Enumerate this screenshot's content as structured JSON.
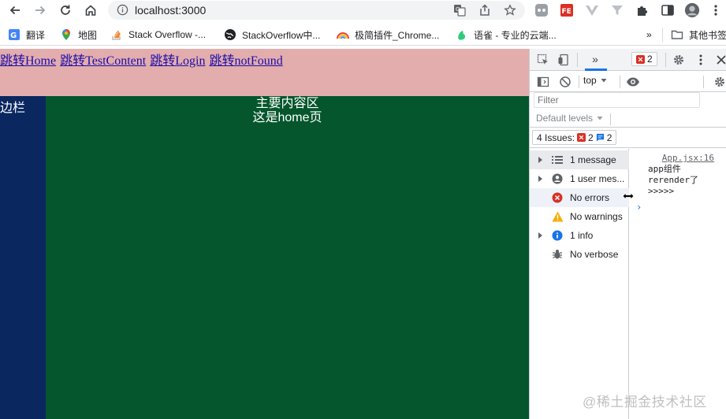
{
  "browser": {
    "url": "localhost:3000"
  },
  "bookmarks": [
    {
      "label": "翻译",
      "icon": "translate-icon"
    },
    {
      "label": "地图",
      "icon": "maps-pin-icon"
    },
    {
      "label": "Stack Overflow -...",
      "icon": "stackoverflow-icon"
    },
    {
      "label": "StackOverflow中...",
      "icon": "globe-icon"
    },
    {
      "label": "极简插件_Chrome...",
      "icon": "rainbow-icon"
    },
    {
      "label": "语雀 - 专业的云端...",
      "icon": "yuque-icon"
    },
    {
      "label": "其他书签",
      "icon": "folder-icon"
    }
  ],
  "bookmarks_more": "»",
  "page": {
    "nav_links": [
      "跳转Home",
      "跳转TestContent",
      "跳转Login",
      "跳转notFound"
    ],
    "sidebar_text": "侧边栏",
    "main_title": "主要内容区",
    "main_subtitle": "这是home页",
    "colors": {
      "header_bg": "#e4adad",
      "sidebar_bg": "#0a2760",
      "main_bg": "#05562d"
    }
  },
  "devtools": {
    "error_count": "2",
    "context": "top",
    "filter_placeholder": "Filter",
    "levels_label": "Default levels",
    "issues_label": "4 Issues:",
    "issues_errors": "2",
    "issues_messages": "2",
    "sidebar_items": [
      {
        "label": "1 message",
        "icon": "list-icon",
        "expandable": true
      },
      {
        "label": "1 user mes...",
        "icon": "user-icon",
        "expandable": true
      },
      {
        "label": "No errors",
        "icon": "error-icon",
        "expandable": false
      },
      {
        "label": "No warnings",
        "icon": "warning-icon",
        "expandable": false
      },
      {
        "label": "1 info",
        "icon": "info-icon",
        "expandable": true
      },
      {
        "label": "No verbose",
        "icon": "bug-icon",
        "expandable": false
      }
    ],
    "console": {
      "source": "App.jsx:16",
      "message": "app组件\nrerender了\n>>>>>",
      "prompt": "›"
    }
  },
  "watermark": "@稀土掘金技术社区"
}
